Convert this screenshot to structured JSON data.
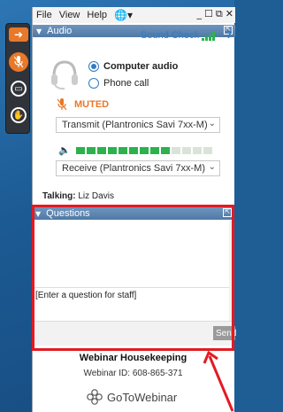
{
  "menu": {
    "file": "File",
    "view": "View",
    "help": "Help"
  },
  "audio": {
    "section_title": "Audio",
    "sound_check": "Sound Check",
    "help_label": "?",
    "computer_audio": "Computer audio",
    "phone_call": "Phone call",
    "selected_mode": "Computer audio",
    "muted_label": "MUTED",
    "transmit_device": "Transmit (Plantronics Savi 7xx-M)",
    "receive_device": "Receive (Plantronics Savi 7xx-M)",
    "meter_level_bars": 9,
    "meter_total_bars": 13,
    "talking_label": "Talking:",
    "talking_name": "Liz Davis"
  },
  "questions": {
    "section_title": "Questions",
    "input_placeholder": "[Enter a question for staff]",
    "send_label": "Send"
  },
  "footer": {
    "title": "Webinar Housekeeping",
    "webinar_id": "Webinar ID: 608-865-371",
    "logo_text": "GoToWebinar"
  },
  "colors": {
    "accent_blue": "#2e7cc6",
    "section_bar": "#5b82ad",
    "muted_orange": "#e8782a",
    "meter_green": "#2bb24c",
    "highlight_red": "#e21b23"
  },
  "icons": {
    "control_panel": [
      "arrow-right-icon",
      "microphone-icon",
      "screen-icon",
      "raise-hand-icon"
    ],
    "menu": [
      "globe-icon",
      "minimize-icon",
      "maximize-icon",
      "close-icon"
    ]
  }
}
